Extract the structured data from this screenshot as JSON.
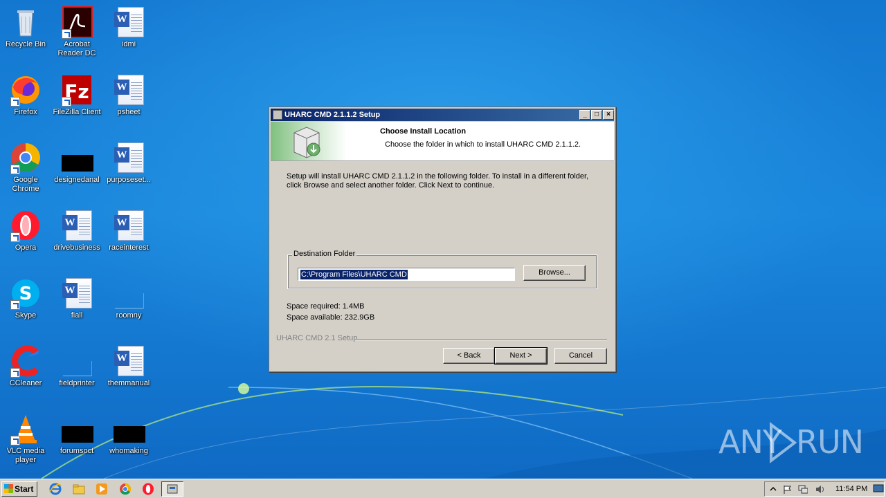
{
  "desktop": {
    "icons": [
      {
        "label": "Recycle Bin"
      },
      {
        "label": "Acrobat Reader DC"
      },
      {
        "label": "idmi"
      },
      {
        "label": "Firefox"
      },
      {
        "label": "FileZilla Client"
      },
      {
        "label": "psheet"
      },
      {
        "label": "Google Chrome"
      },
      {
        "label": "designedanal"
      },
      {
        "label": "purposeset..."
      },
      {
        "label": "Opera"
      },
      {
        "label": "drivebusiness"
      },
      {
        "label": "raceinterest"
      },
      {
        "label": "Skype"
      },
      {
        "label": "fiall"
      },
      {
        "label": "roomny"
      },
      {
        "label": "CCleaner"
      },
      {
        "label": "fieldprinter"
      },
      {
        "label": "themmanual"
      },
      {
        "label": "VLC media player"
      },
      {
        "label": "forumsoct"
      },
      {
        "label": "whomaking"
      }
    ]
  },
  "setup": {
    "title": "UHARC CMD 2.1.1.2 Setup",
    "header_title": "Choose Install Location",
    "header_subtitle": "Choose the folder in which to install UHARC CMD 2.1.1.2.",
    "description": "Setup will install UHARC CMD 2.1.1.2 in the following folder. To install in a different folder, click Browse and select another folder. Click Next to continue.",
    "destination_legend": "Destination Folder",
    "destination_value": "C:\\Program Files\\UHARC CMD",
    "browse_label": "Browse...",
    "space_required": "Space required: 1.4MB",
    "space_available": "Space available: 232.9GB",
    "footer_brand": "UHARC CMD 2.1 Setup",
    "back_label": "< Back",
    "next_label": "Next >",
    "cancel_label": "Cancel",
    "caption_minimize": "_",
    "caption_maximize": "□",
    "caption_close": "×"
  },
  "taskbar": {
    "start_label": "Start",
    "clock": "11:54 PM"
  },
  "watermark": {
    "left": "ANY",
    "right": "RUN"
  },
  "colors": {
    "title_gradient_start": "#0a246a",
    "title_gradient_end": "#3a6ea5",
    "dialog_face": "#d4d0c8",
    "wallpaper": "#1a86dc"
  }
}
